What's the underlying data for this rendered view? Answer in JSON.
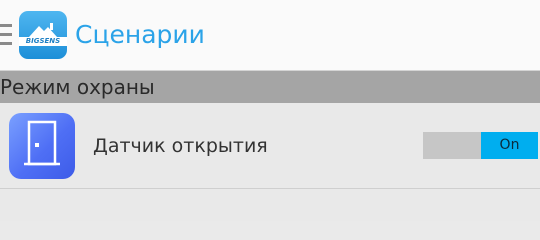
{
  "action_bar": {
    "title": "Сценарии",
    "logo_text": "BIGSENS",
    "menu_icon": "hamburger-menu-icon",
    "title_color": "#2ba3e8"
  },
  "section": {
    "title": "Режим охраны"
  },
  "items": [
    {
      "label": "Датчик открытия",
      "icon": "door-sensor-icon",
      "toggle_label": "On",
      "toggle_on": true,
      "toggle_color": "#00aeef"
    }
  ]
}
